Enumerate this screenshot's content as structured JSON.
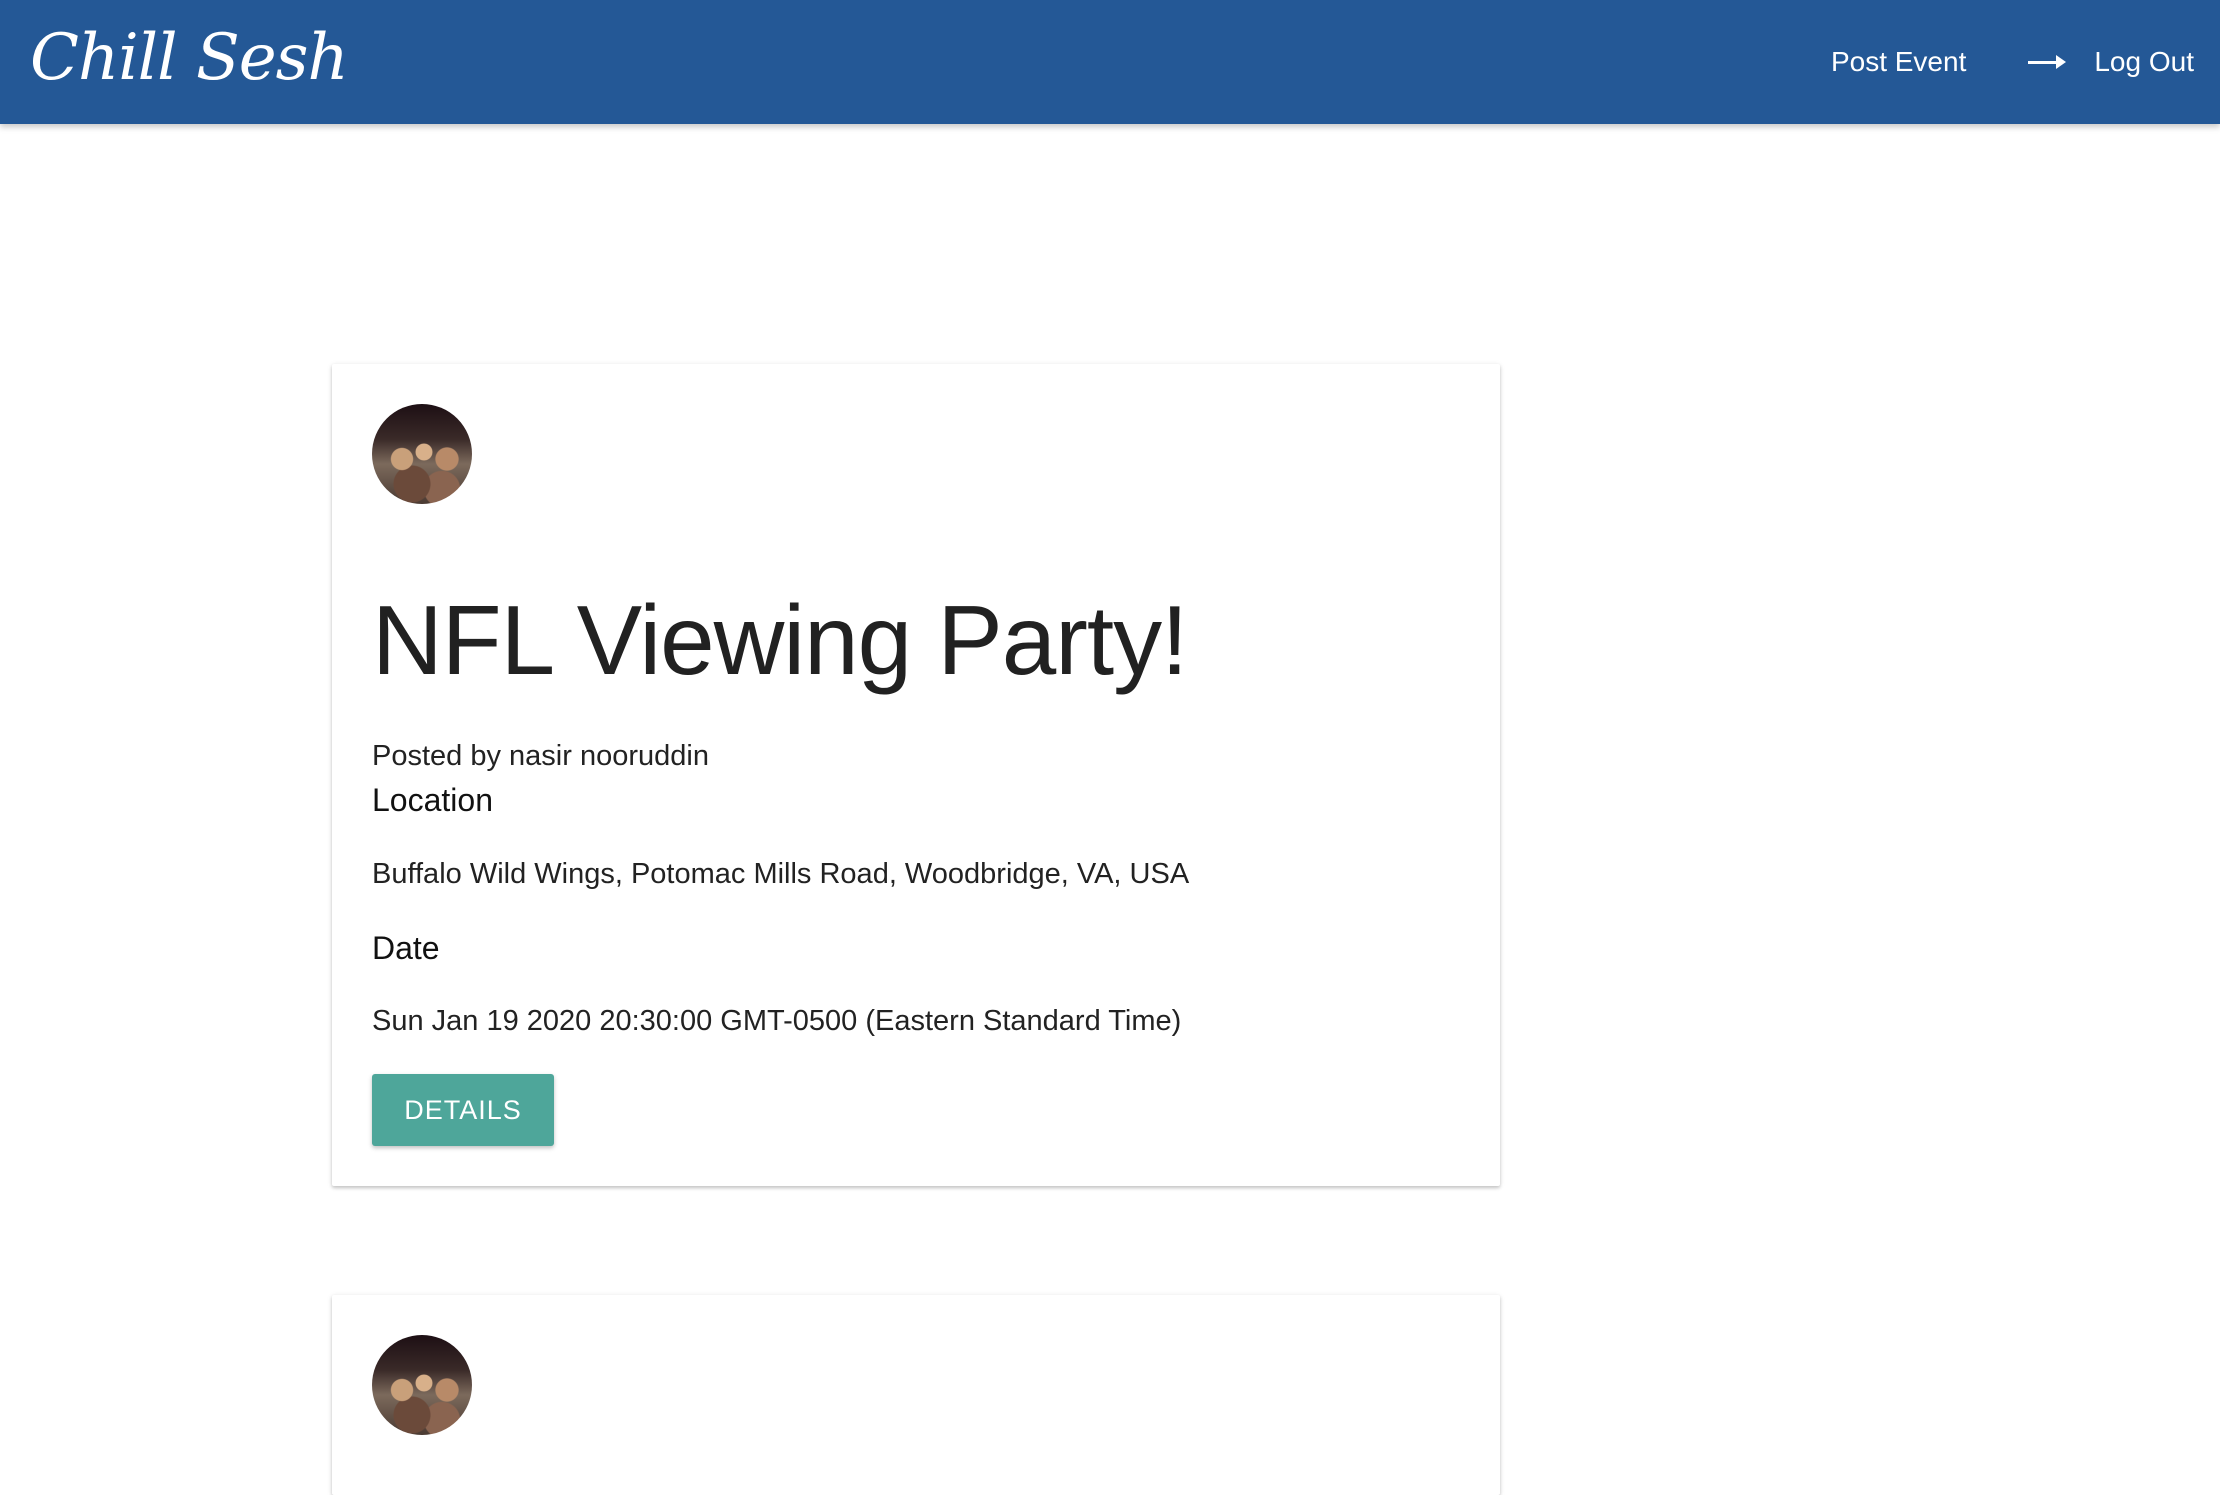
{
  "nav": {
    "brand": "Chill Sesh",
    "post_event": "Post Event",
    "logout_icon": "arrow-right-icon",
    "logout": "Log Out"
  },
  "events": [
    {
      "title": "NFL Viewing Party!",
      "posted_by": "Posted by nasir nooruddin",
      "location_label": "Location",
      "location": "Buffalo Wild Wings, Potomac Mills Road, Woodbridge, VA, USA",
      "date_label": "Date",
      "date": "Sun Jan 19 2020 20:30:00 GMT-0500 (Eastern Standard Time)",
      "details_label": "DETAILS"
    }
  ],
  "colors": {
    "navbar": "#245896",
    "details_button": "#4ea69a"
  }
}
